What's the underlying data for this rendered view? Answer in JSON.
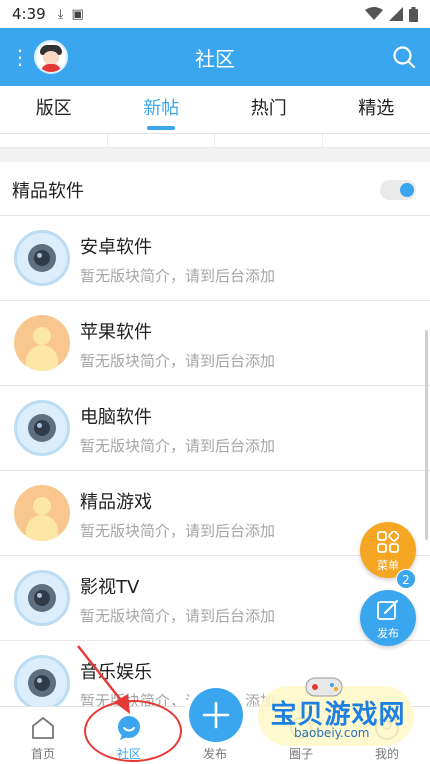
{
  "status_bar": {
    "time": "4:39"
  },
  "app_bar": {
    "title": "社区"
  },
  "tabs": [
    {
      "label": "版区"
    },
    {
      "label": "新帖"
    },
    {
      "label": "热门"
    },
    {
      "label": "精选"
    }
  ],
  "section": {
    "title": "精品软件"
  },
  "forums": [
    {
      "title": "安卓软件",
      "desc": "暂无版块简介，请到后台添加",
      "icon": "camera-icon"
    },
    {
      "title": "苹果软件",
      "desc": "暂无版块简介，请到后台添加",
      "icon": "person-icon"
    },
    {
      "title": "电脑软件",
      "desc": "暂无版块简介，请到后台添加",
      "icon": "camera-icon"
    },
    {
      "title": "精品游戏",
      "desc": "暂无版块简介，请到后台添加",
      "icon": "person-icon"
    },
    {
      "title": "影视TV",
      "desc": "暂无版块简介，请到后台添加",
      "icon": "camera-icon"
    },
    {
      "title": "音乐娱乐",
      "desc": "暂无版块简介，请到后台添加",
      "icon": "camera-icon"
    }
  ],
  "fab": {
    "menu_label": "菜单",
    "menu_badge": "2",
    "post_label": "发布"
  },
  "bottom_nav": [
    {
      "label": "首页"
    },
    {
      "label": "社区"
    },
    {
      "label": "发布"
    },
    {
      "label": "圈子"
    },
    {
      "label": "我的"
    }
  ],
  "watermark": {
    "text": "宝贝游戏网",
    "url": "baobeiy.com"
  },
  "colors": {
    "primary": "#3aa6ef",
    "accent": "#f5a623",
    "annotation": "#e53935"
  }
}
